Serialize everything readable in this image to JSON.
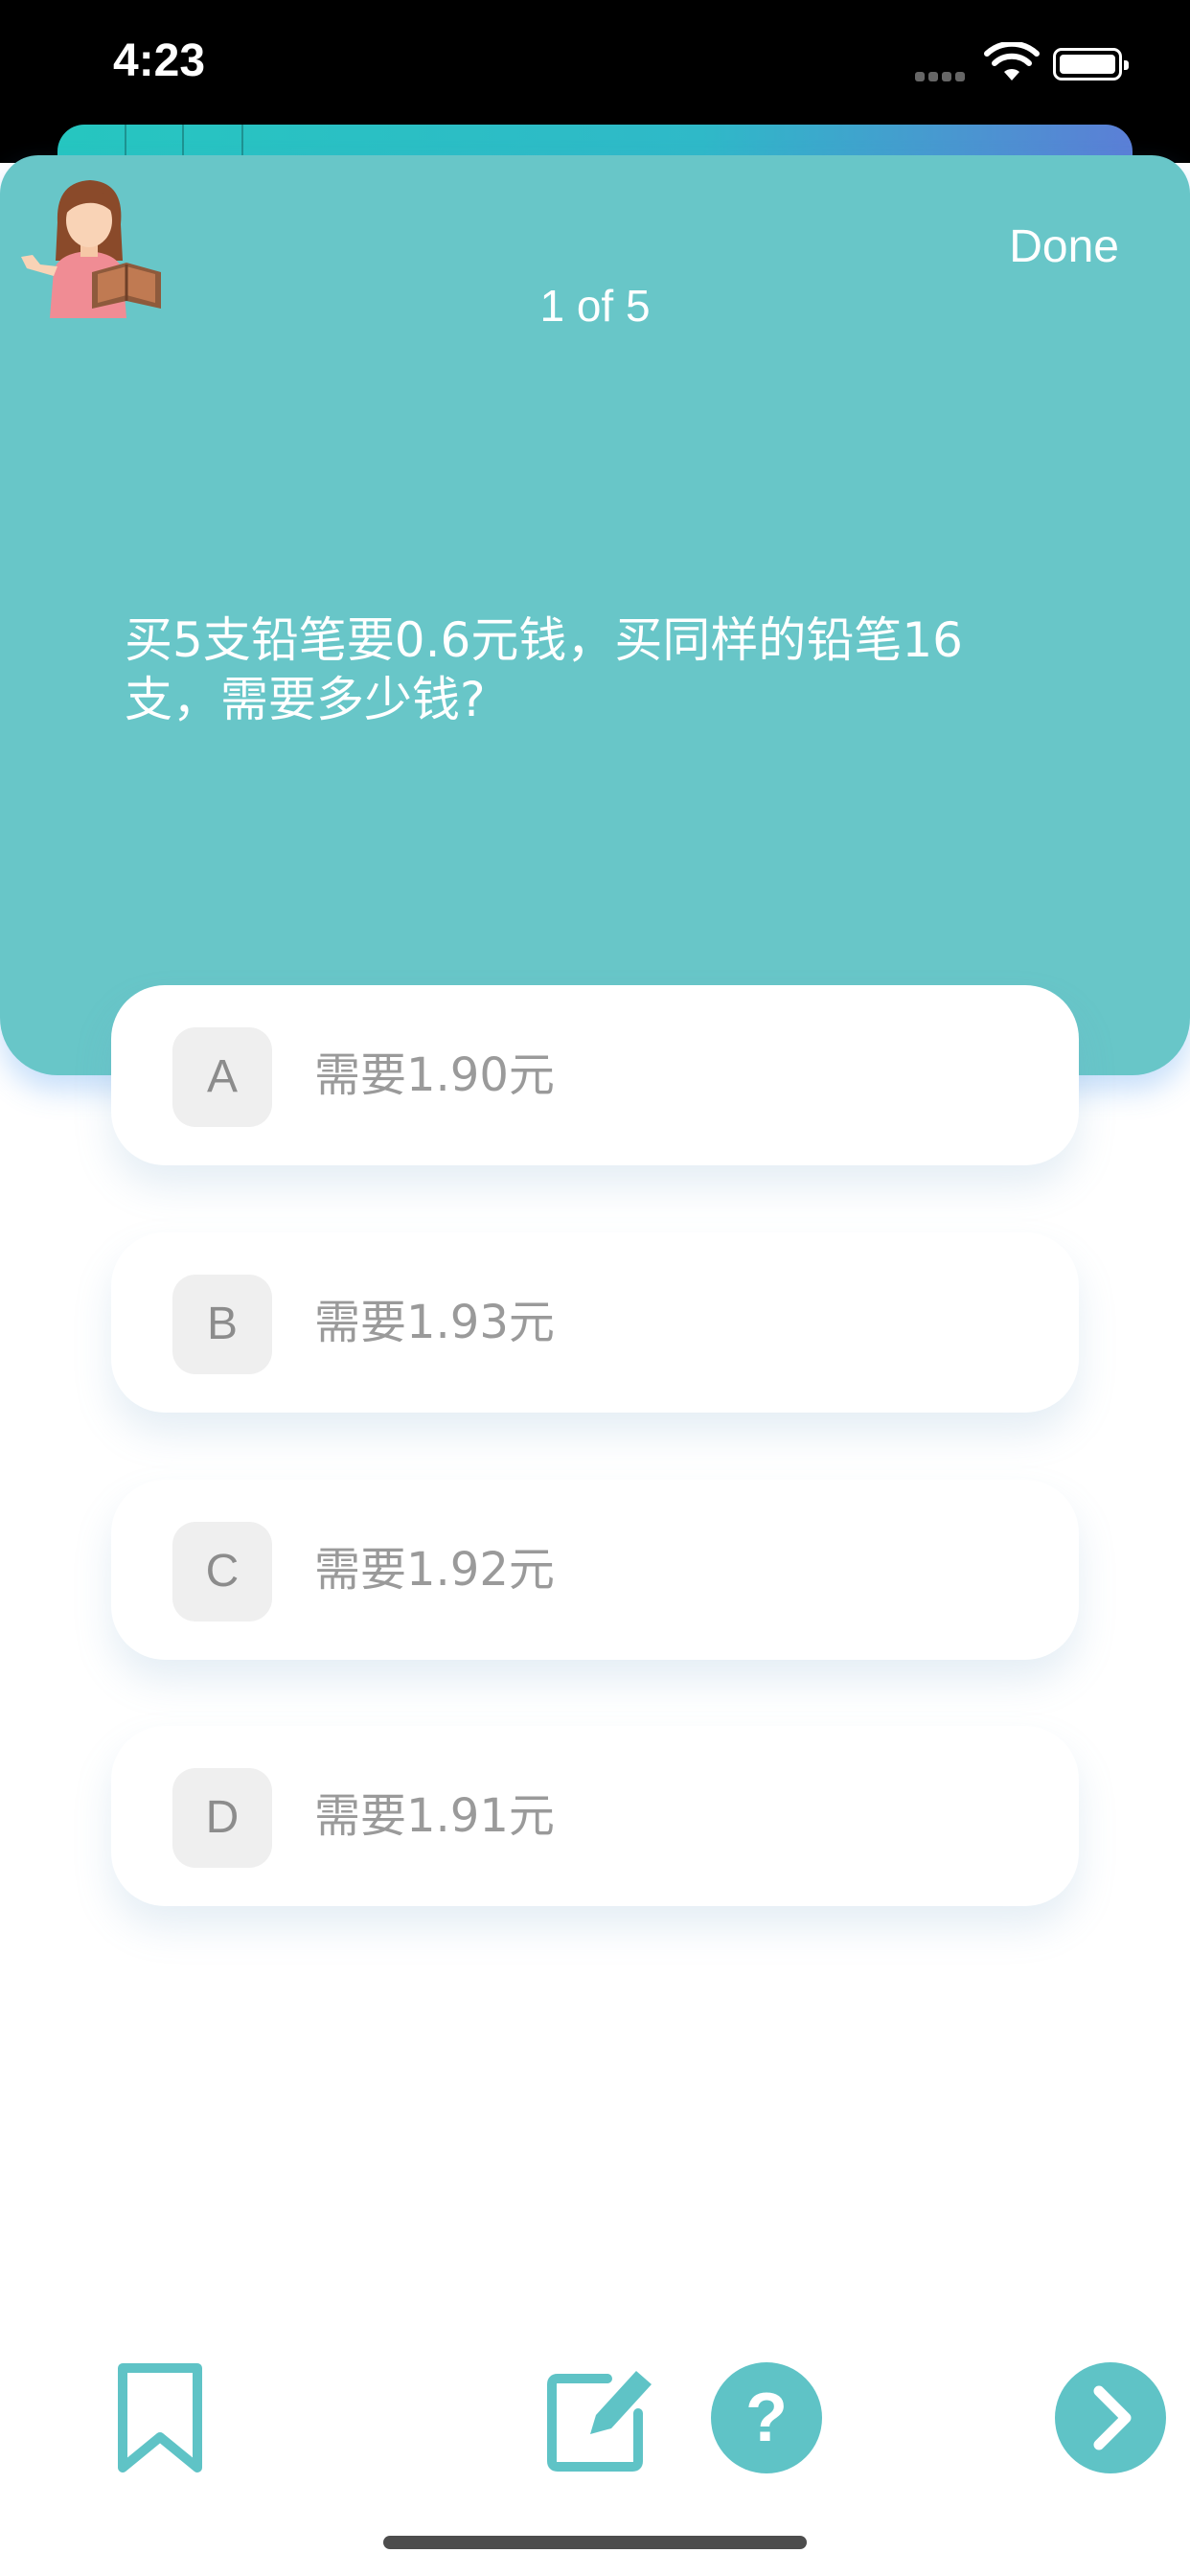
{
  "status": {
    "time": "4:23"
  },
  "header": {
    "done_label": "Done",
    "counter": "1 of 5"
  },
  "question": {
    "text": "买5支铅笔要0.6元钱，买同样的铅笔16支，需要多少钱?"
  },
  "options": [
    {
      "letter": "A",
      "text": "需要1.90元"
    },
    {
      "letter": "B",
      "text": "需要1.93元"
    },
    {
      "letter": "C",
      "text": "需要1.92元"
    },
    {
      "letter": "D",
      "text": "需要1.91元"
    }
  ],
  "toolbar": {
    "help_label": "?"
  },
  "colors": {
    "accent": "#68c6c8",
    "icon": "#5fc3c6",
    "option_text": "#9a9a9a"
  },
  "icons": [
    "teacher-avatar-icon",
    "bookmark-icon",
    "edit-icon",
    "help-icon",
    "chevron-right-icon"
  ]
}
